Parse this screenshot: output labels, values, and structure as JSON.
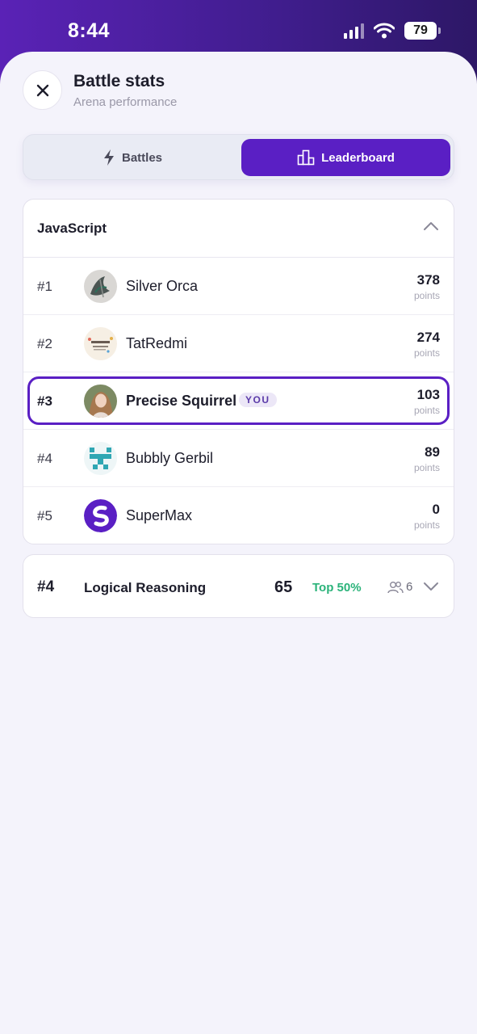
{
  "status": {
    "time": "8:44",
    "battery": "79"
  },
  "header": {
    "title": "Battle stats",
    "subtitle": "Arena performance"
  },
  "tabs": [
    {
      "label": "Battles",
      "active": false
    },
    {
      "label": "Leaderboard",
      "active": true
    }
  ],
  "leaderboard": {
    "category": "JavaScript",
    "points_label": "points",
    "you_label": "YOU",
    "rows": [
      {
        "rank": "#1",
        "name": "Silver Orca",
        "points": "378"
      },
      {
        "rank": "#2",
        "name": "TatRedmi",
        "points": "274"
      },
      {
        "rank": "#3",
        "name": "Precise Squirrel",
        "points": "103"
      },
      {
        "rank": "#4",
        "name": "Bubbly Gerbil",
        "points": "89"
      },
      {
        "rank": "#5",
        "name": "SuperMax",
        "points": "0"
      }
    ]
  },
  "other_category": {
    "rank": "#4",
    "name": "Logical Reasoning",
    "score": "65",
    "percentile": "Top 50%",
    "participants": "6"
  },
  "colors": {
    "accent": "#5a1fc4",
    "success": "#2bb37a"
  }
}
